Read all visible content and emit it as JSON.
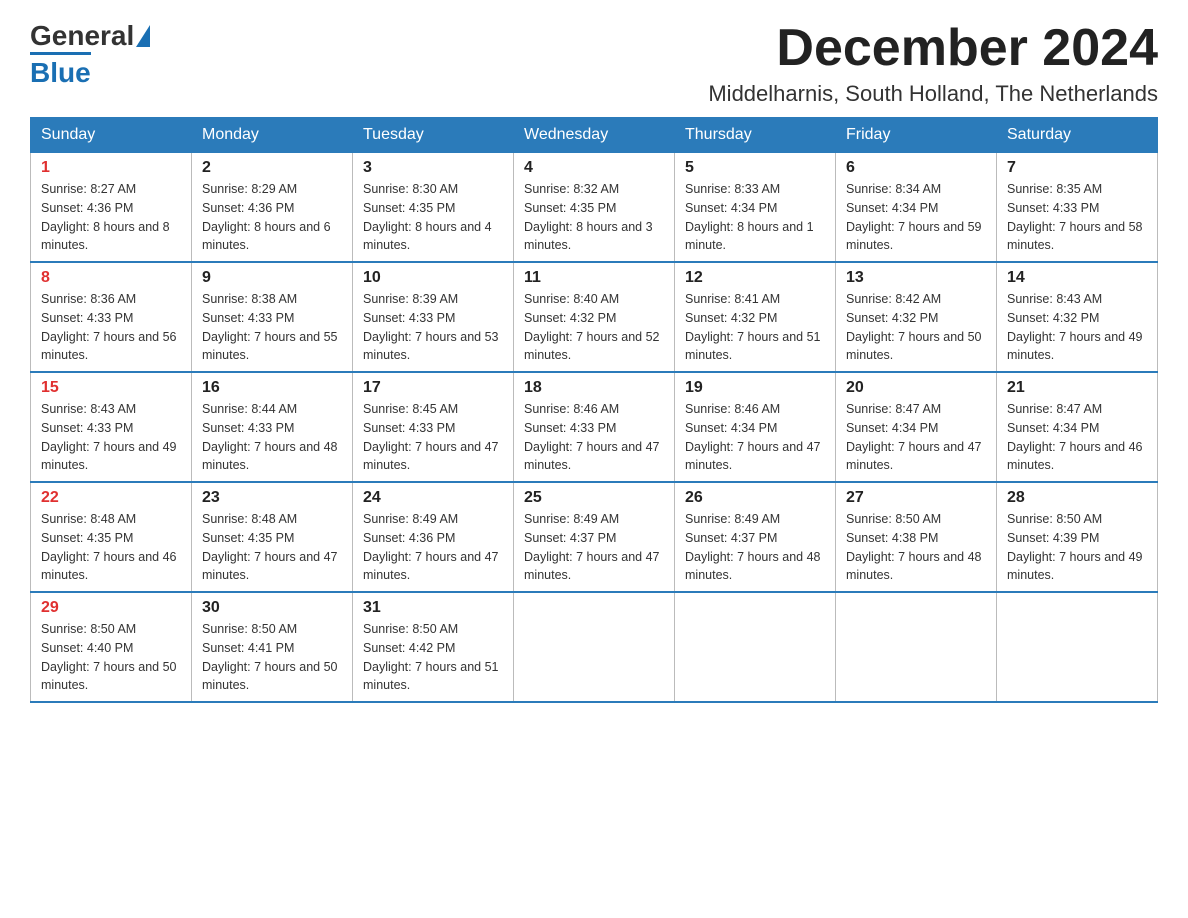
{
  "logo": {
    "general": "General",
    "blue": "Blue",
    "tagline": "Blue"
  },
  "title": {
    "month_year": "December 2024",
    "location": "Middelharnis, South Holland, The Netherlands"
  },
  "weekdays": [
    "Sunday",
    "Monday",
    "Tuesday",
    "Wednesday",
    "Thursday",
    "Friday",
    "Saturday"
  ],
  "weeks": [
    [
      {
        "date": "1",
        "sunrise": "8:27 AM",
        "sunset": "4:36 PM",
        "daylight": "8 hours and 8 minutes."
      },
      {
        "date": "2",
        "sunrise": "8:29 AM",
        "sunset": "4:36 PM",
        "daylight": "8 hours and 6 minutes."
      },
      {
        "date": "3",
        "sunrise": "8:30 AM",
        "sunset": "4:35 PM",
        "daylight": "8 hours and 4 minutes."
      },
      {
        "date": "4",
        "sunrise": "8:32 AM",
        "sunset": "4:35 PM",
        "daylight": "8 hours and 3 minutes."
      },
      {
        "date": "5",
        "sunrise": "8:33 AM",
        "sunset": "4:34 PM",
        "daylight": "8 hours and 1 minute."
      },
      {
        "date": "6",
        "sunrise": "8:34 AM",
        "sunset": "4:34 PM",
        "daylight": "7 hours and 59 minutes."
      },
      {
        "date": "7",
        "sunrise": "8:35 AM",
        "sunset": "4:33 PM",
        "daylight": "7 hours and 58 minutes."
      }
    ],
    [
      {
        "date": "8",
        "sunrise": "8:36 AM",
        "sunset": "4:33 PM",
        "daylight": "7 hours and 56 minutes."
      },
      {
        "date": "9",
        "sunrise": "8:38 AM",
        "sunset": "4:33 PM",
        "daylight": "7 hours and 55 minutes."
      },
      {
        "date": "10",
        "sunrise": "8:39 AM",
        "sunset": "4:33 PM",
        "daylight": "7 hours and 53 minutes."
      },
      {
        "date": "11",
        "sunrise": "8:40 AM",
        "sunset": "4:32 PM",
        "daylight": "7 hours and 52 minutes."
      },
      {
        "date": "12",
        "sunrise": "8:41 AM",
        "sunset": "4:32 PM",
        "daylight": "7 hours and 51 minutes."
      },
      {
        "date": "13",
        "sunrise": "8:42 AM",
        "sunset": "4:32 PM",
        "daylight": "7 hours and 50 minutes."
      },
      {
        "date": "14",
        "sunrise": "8:43 AM",
        "sunset": "4:32 PM",
        "daylight": "7 hours and 49 minutes."
      }
    ],
    [
      {
        "date": "15",
        "sunrise": "8:43 AM",
        "sunset": "4:33 PM",
        "daylight": "7 hours and 49 minutes."
      },
      {
        "date": "16",
        "sunrise": "8:44 AM",
        "sunset": "4:33 PM",
        "daylight": "7 hours and 48 minutes."
      },
      {
        "date": "17",
        "sunrise": "8:45 AM",
        "sunset": "4:33 PM",
        "daylight": "7 hours and 47 minutes."
      },
      {
        "date": "18",
        "sunrise": "8:46 AM",
        "sunset": "4:33 PM",
        "daylight": "7 hours and 47 minutes."
      },
      {
        "date": "19",
        "sunrise": "8:46 AM",
        "sunset": "4:34 PM",
        "daylight": "7 hours and 47 minutes."
      },
      {
        "date": "20",
        "sunrise": "8:47 AM",
        "sunset": "4:34 PM",
        "daylight": "7 hours and 47 minutes."
      },
      {
        "date": "21",
        "sunrise": "8:47 AM",
        "sunset": "4:34 PM",
        "daylight": "7 hours and 46 minutes."
      }
    ],
    [
      {
        "date": "22",
        "sunrise": "8:48 AM",
        "sunset": "4:35 PM",
        "daylight": "7 hours and 46 minutes."
      },
      {
        "date": "23",
        "sunrise": "8:48 AM",
        "sunset": "4:35 PM",
        "daylight": "7 hours and 47 minutes."
      },
      {
        "date": "24",
        "sunrise": "8:49 AM",
        "sunset": "4:36 PM",
        "daylight": "7 hours and 47 minutes."
      },
      {
        "date": "25",
        "sunrise": "8:49 AM",
        "sunset": "4:37 PM",
        "daylight": "7 hours and 47 minutes."
      },
      {
        "date": "26",
        "sunrise": "8:49 AM",
        "sunset": "4:37 PM",
        "daylight": "7 hours and 48 minutes."
      },
      {
        "date": "27",
        "sunrise": "8:50 AM",
        "sunset": "4:38 PM",
        "daylight": "7 hours and 48 minutes."
      },
      {
        "date": "28",
        "sunrise": "8:50 AM",
        "sunset": "4:39 PM",
        "daylight": "7 hours and 49 minutes."
      }
    ],
    [
      {
        "date": "29",
        "sunrise": "8:50 AM",
        "sunset": "4:40 PM",
        "daylight": "7 hours and 50 minutes."
      },
      {
        "date": "30",
        "sunrise": "8:50 AM",
        "sunset": "4:41 PM",
        "daylight": "7 hours and 50 minutes."
      },
      {
        "date": "31",
        "sunrise": "8:50 AM",
        "sunset": "4:42 PM",
        "daylight": "7 hours and 51 minutes."
      },
      null,
      null,
      null,
      null
    ]
  ]
}
